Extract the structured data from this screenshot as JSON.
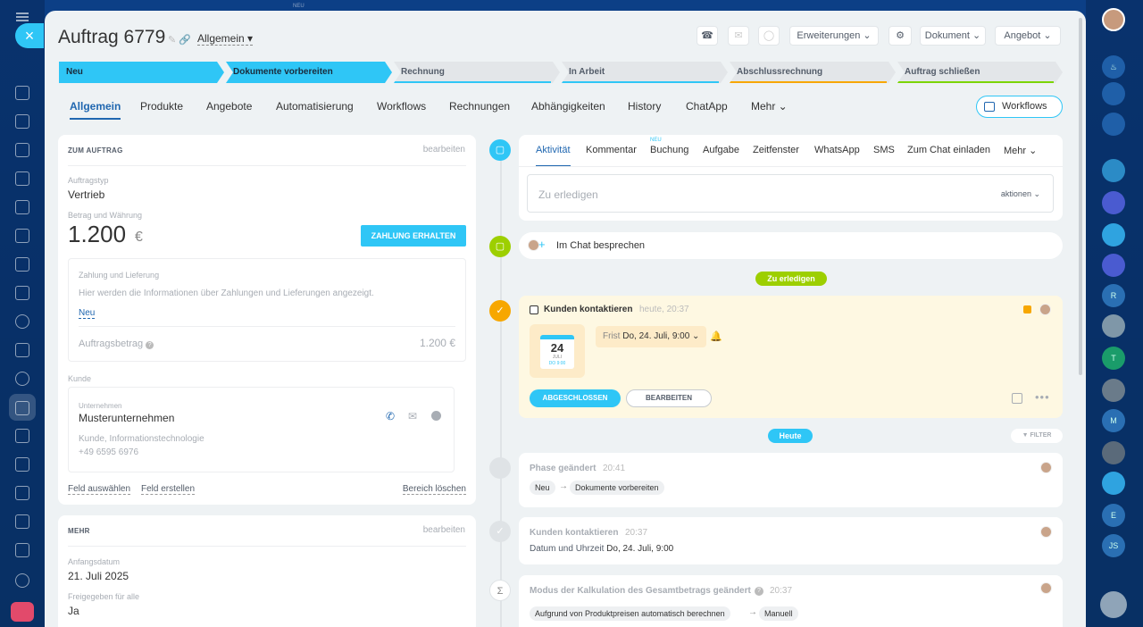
{
  "header": {
    "title": "Auftrag 6779",
    "category": "Allgemein",
    "buttons": {
      "erweiterungen": "Erweiterungen",
      "dokument": "Dokument",
      "angebot": "Angebot"
    },
    "bg_neu": "NEU"
  },
  "stages": [
    "Neu",
    "Dokumente vorbereiten",
    "Rechnung",
    "In Arbeit",
    "Abschlussrechnung",
    "Auftrag schließen"
  ],
  "tabs": [
    "Allgemein",
    "Produkte",
    "Angebote",
    "Automatisierung",
    "Workflows",
    "Rechnungen",
    "Abhängigkeiten",
    "History",
    "ChatApp",
    "Mehr"
  ],
  "workflows_button": "Workflows",
  "order_section": {
    "heading": "ZUM AUFTRAG",
    "edit": "bearbeiten",
    "type_label": "Auftragstyp",
    "type_value": "Vertrieb",
    "amount_label": "Betrag und Währung",
    "amount": "1.200",
    "currency": "€",
    "pay_button": "ZAHLUNG ERHALTEN",
    "payment_title": "Zahlung und Lieferung",
    "payment_text": "Hier werden die Informationen über Zahlungen und Lieferungen angezeigt.",
    "payment_new": "Neu",
    "order_amount_label": "Auftragsbetrag",
    "order_amount_value": "1.200 €",
    "customer_label": "Kunde",
    "company_label": "Unternehmen",
    "company_name": "Musterunternehmen",
    "company_meta": "Kunde, Informationstechnologie",
    "company_phone": "+49 6595 6976",
    "link_select": "Feld auswählen",
    "link_create": "Feld erstellen",
    "link_delete": "Bereich löschen"
  },
  "more_section": {
    "heading": "MEHR",
    "edit": "bearbeiten",
    "start_label": "Anfangsdatum",
    "start_value": "21. Juli 2025",
    "shared_label": "Freigegeben für alle",
    "shared_value": "Ja"
  },
  "activity_tabs": [
    "Aktivität",
    "Kommentar",
    "Buchung",
    "Aufgabe",
    "Zeitfenster",
    "WhatsApp",
    "SMS",
    "Zum Chat einladen",
    "Mehr"
  ],
  "activity_new_badge": "NEU",
  "todo_placeholder": "Zu erledigen",
  "todo_actions": "aktionen",
  "chat_discuss": "Im Chat besprechen",
  "todo_pill": "Zu erledigen",
  "task": {
    "title": "Kunden kontaktieren",
    "time": "heute, 20:37",
    "cal_day": "24",
    "cal_month": "JULI",
    "cal_time": "DO 9:00",
    "deadline_label": "Frist",
    "deadline_value": "Do, 24. Juli, 9:00",
    "done_button": "ABGESCHLOSSEN",
    "edit_button": "BEARBEITEN"
  },
  "today_pill": "Heute",
  "filter": "FILTER",
  "events": [
    {
      "title": "Phase geändert",
      "time": "20:41",
      "from": "Neu",
      "to": "Dokumente vorbereiten"
    },
    {
      "title": "Kunden kontaktieren",
      "time": "20:37",
      "detail_label": "Datum und Uhrzeit",
      "detail_value": "Do, 24. Juli, 9:00"
    },
    {
      "title": "Modus der Kalkulation des Gesamtbetrags geändert",
      "time": "20:37",
      "from": "Aufgrund von Produktpreisen automatisch berechnen",
      "to": "Manuell"
    }
  ],
  "right_avatars": [
    "R",
    "T",
    "M",
    "E",
    "JS"
  ],
  "colors": {
    "accent": "#2fc6f6",
    "stage_neu_bar": "#2fc6f6",
    "stage_abschluss_bar": "#f7a700",
    "stage_schliessen_bar": "#7bd500",
    "todo_green": "#9dcf00",
    "task_bg": "#fef8e2"
  }
}
